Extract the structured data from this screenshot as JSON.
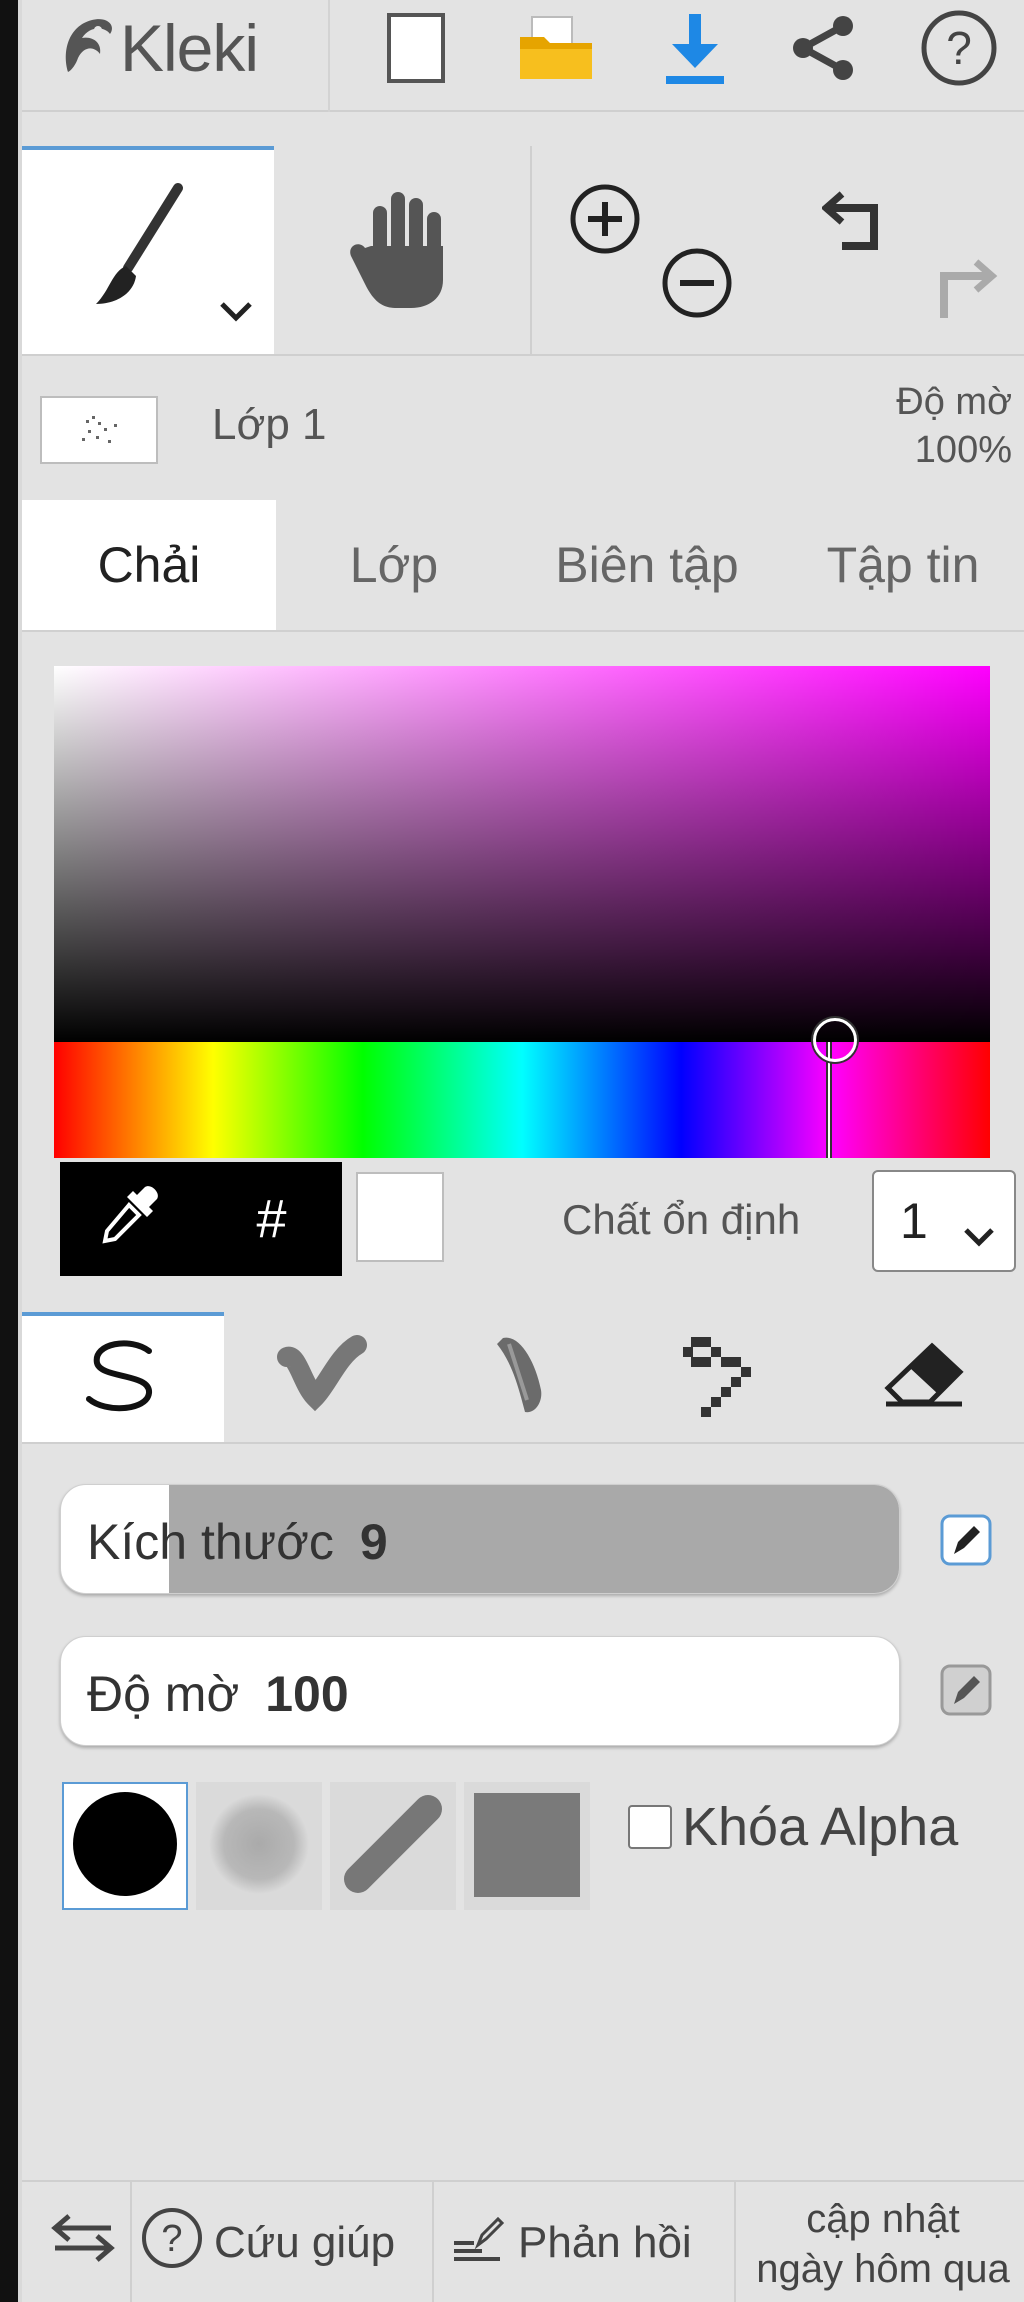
{
  "app": {
    "name": "Kleki"
  },
  "layer": {
    "name": "Lớp 1",
    "opacity_label": "Độ mờ",
    "opacity_value": "100%"
  },
  "main_tabs": [
    {
      "label": "Chải",
      "active": true
    },
    {
      "label": "Lớp",
      "active": false
    },
    {
      "label": "Biên tập",
      "active": false
    },
    {
      "label": "Tập tin",
      "active": false
    }
  ],
  "color_picker": {
    "hue_color": "#ff00ff",
    "selected_color": "#ffffff",
    "hex_symbol": "#",
    "stabilizer_label": "Chất ổn định",
    "stabilizer_value": "1"
  },
  "brush_settings": {
    "size_label": "Kích thước",
    "size_value": "9",
    "opacity_label": "Độ mờ",
    "opacity_value": "100",
    "alpha_lock_label": "Khóa Alpha"
  },
  "footer": {
    "help_label": "Cứu giúp",
    "feedback_label": "Phản hồi",
    "update_line1": "cập nhật",
    "update_line2": "ngày hôm qua"
  },
  "colors": {
    "accent": "#5b9bd5",
    "panel_bg": "#e3e3e3",
    "icon_gray": "#555555",
    "folder_yellow": "#f5b800",
    "download_blue": "#1e88e5"
  }
}
